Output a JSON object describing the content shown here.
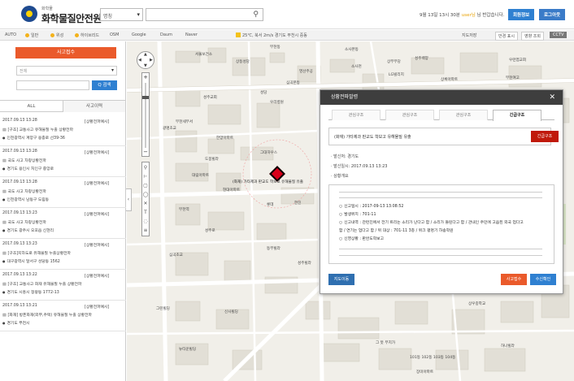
{
  "header": {
    "logo_subtitle": "화학물",
    "logo_title": "화학물질안전원",
    "search_type": "명칭",
    "welcome_prefix": "9월 13일 13시 30분",
    "welcome_user": "user님",
    "welcome_suffix": "님 반갑습니다.",
    "btn_info": "회원정보",
    "btn_logout": "로그아웃"
  },
  "toolbar": {
    "items": [
      "AUTO",
      "일반",
      "위성",
      "하이브리드",
      "OSM",
      "Google",
      "Daum",
      "Naver"
    ],
    "weather": "25℃, 북서 2m/s 경기도 부천시 중동",
    "map_save": "지도저장",
    "map_btn1": "반경 표시",
    "map_btn2": "영향 조회",
    "cctv": "CCTV"
  },
  "sidebar": {
    "report_btn": "사고접수",
    "select_placeholder": "전체",
    "search_btn": "Q 검색",
    "tab_all": "ALL",
    "tab_2": "사고이력",
    "items": [
      {
        "date": "2017.09.13 13:28",
        "status": "[상황전파예시]",
        "title": "[구조] 교통사고 유해물질 누출 상황전파",
        "addr": "인천광역시 계양구 용종로 선39-36"
      },
      {
        "date": "2017.09.13 13:28",
        "status": "[상황전파예시]",
        "title": "국도 사고 차량상황전파",
        "addr": "경기도 용인시 처인구 중앙로"
      },
      {
        "date": "2017.09.13 13:28",
        "status": "[상황전파예시]",
        "title": "국도 사고 차량상황전파",
        "addr": "인천광역시 남동구 도림동"
      },
      {
        "date": "2017.09.13 13:23",
        "status": "[상황전파예시]",
        "title": "국도 사고 차량상황전파",
        "addr": "경기도 광주시 오포읍 신현리"
      },
      {
        "date": "2017.09.13 13:23",
        "status": "[상황전파예시]",
        "title": "[구조]지하도로 유해물질 누출상황전파",
        "addr": "대구광역시 달서구 성당동 1562"
      },
      {
        "date": "2017.09.13 13:22",
        "status": "[상황전파예시]",
        "title": "[구조] 교통사고 화재 유해물질 누출 상황전파",
        "addr": "경기도 시흥시 정왕동 1772-13"
      },
      {
        "date": "2017.09.13 13:21",
        "status": "[상황전파예시]",
        "title": "[화재] 방폰화재(외부,주택) 유해물질 누출 상황전파",
        "addr": "경기도 부천시"
      }
    ]
  },
  "map": {
    "labels": [
      "부천동",
      "서울보건소",
      "상동성당",
      "소사본동",
      "상부무당",
      "성주백양",
      "소사천",
      "LG빌리지",
      "영산주공",
      "상록아파트",
      "우련엽교회",
      "부천여고",
      "심곡본동",
      "성당",
      "우리병원",
      "광명초교",
      "부천세무서",
      "성주교회",
      "도봉빌라",
      "그대하우스",
      "한양아파트",
      "대림아파트",
      "현대아파트",
      "한진",
      "롯데",
      "(화재) 가타제과 판교도 학보고 유해물질 유출",
      "부천역",
      "성주로",
      "심곡초교",
      "동부빌라",
      "그린빌딩",
      "뉴타운빌딩",
      "신사빌딩",
      "성주빌라",
      "상우중학교",
      "그 뜻 부지가",
      "101동 102동 103동 104동",
      "장미아파트",
      "하나빌라"
    ]
  },
  "dialog": {
    "title": "상황전파발령",
    "tabs": [
      "관심구조",
      "관심구조",
      "관심구조",
      "긴급구조"
    ],
    "type_text": "(화재) 가타제과 판교도 학보고 유해물질 유출",
    "urgent_btn": "긴급구조",
    "field_sender": "· 발신처: 경기도",
    "field_time": "· 발신일시: 2017.09.13 13:23",
    "field_overview": "· 상황개요",
    "rows": [
      "신고일시 : 2017-09-13 13:08:52",
      "발생위치 : 701-11",
      "신고내역 : 관련진에서 전기 트리는 소리가 난다고 함 / 소리가 들린다고 함 / 관내인 주민에 고음된 외국 업다고",
      "함 / 연기는 업다고 함 / 위 대상 : 701-11 3층 / 위크 평명기 하송학원",
      "신영상황 : 판완도학보고"
    ],
    "btn_map": "지도이동",
    "btn_report": "사고접수",
    "btn_confirm": "수신확인"
  },
  "colors": {
    "accent_orange": "#ea5a2b",
    "accent_blue": "#2f80d1",
    "urgent_red": "#c0190a",
    "dialog_header": "#3e3e3e",
    "map_bg": "#f1efe9"
  }
}
